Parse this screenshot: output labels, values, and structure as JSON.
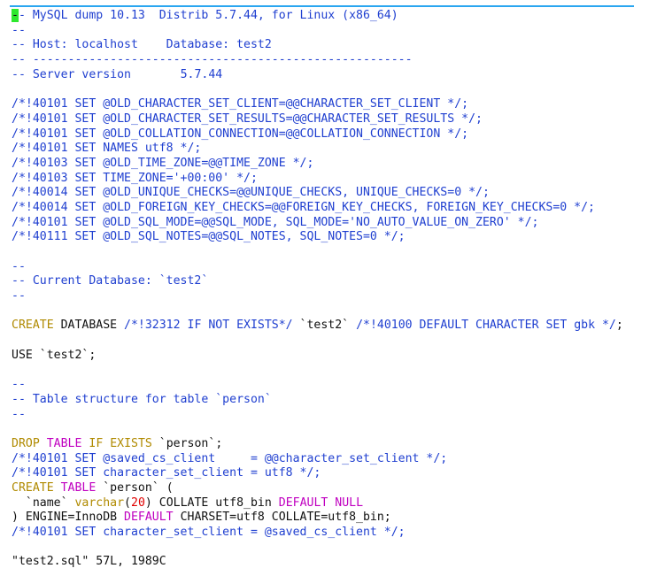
{
  "colors": {
    "accent_bar": "#2aa6f0",
    "cursor": "#2ee82e",
    "comment": "#1f3fd0",
    "keyword": "#b08a00",
    "type": "#c000c0",
    "number": "#e00000",
    "text": "#111111"
  },
  "editor": {
    "cursor_char": "-",
    "l1": "- MySQL dump 10.13  Distrib 5.7.44, for Linux (x86_64)",
    "l2": "--",
    "l3": "-- Host: localhost    Database: test2",
    "l4": "-- ------------------------------------------------------",
    "l5": "-- Server version\t5.7.44",
    "l6": "",
    "l7": "/*!40101 SET @OLD_CHARACTER_SET_CLIENT=@@CHARACTER_SET_CLIENT */;",
    "l8": "/*!40101 SET @OLD_CHARACTER_SET_RESULTS=@@CHARACTER_SET_RESULTS */;",
    "l9": "/*!40101 SET @OLD_COLLATION_CONNECTION=@@COLLATION_CONNECTION */;",
    "l10": "/*!40101 SET NAMES utf8 */;",
    "l11": "/*!40103 SET @OLD_TIME_ZONE=@@TIME_ZONE */;",
    "l12": "/*!40103 SET TIME_ZONE='+00:00' */;",
    "l13": "/*!40014 SET @OLD_UNIQUE_CHECKS=@@UNIQUE_CHECKS, UNIQUE_CHECKS=0 */;",
    "l14": "/*!40014 SET @OLD_FOREIGN_KEY_CHECKS=@@FOREIGN_KEY_CHECKS, FOREIGN_KEY_CHECKS=0 */;",
    "l15": "/*!40101 SET @OLD_SQL_MODE=@@SQL_MODE, SQL_MODE='NO_AUTO_VALUE_ON_ZERO' */;",
    "l16": "/*!40111 SET @OLD_SQL_NOTES=@@SQL_NOTES, SQL_NOTES=0 */;",
    "l17": "",
    "l18": "--",
    "l19": "-- Current Database: `test2`",
    "l20": "--",
    "l21": "",
    "l22": {
      "kw": "CREATE",
      "a": " DATABASE ",
      "c1": "/*!32312 IF NOT EXISTS*/",
      "b": " `test2` ",
      "c2": "/*!40100 DEFAULT CHARACTER SET gbk */",
      "e": ";"
    },
    "l23": "",
    "l24": "USE `test2`;",
    "l25": "",
    "l26": "--",
    "l27": "-- Table structure for table `person`",
    "l28": "--",
    "l29": "",
    "l30": {
      "kw1": "DROP",
      "sp1": " ",
      "kw2": "TABLE",
      "sp2": " ",
      "kw3": "IF",
      "sp3": " ",
      "kw4": "EXISTS",
      "rest": " `person`;"
    },
    "l31": "/*!40101 SET @saved_cs_client     = @@character_set_client */;",
    "l32": "/*!40101 SET character_set_client = utf8 */;",
    "l33": {
      "kw1": "CREATE",
      "sp1": " ",
      "kw2": "TABLE",
      "rest": " `person` ("
    },
    "l34": {
      "pre": "  `name` ",
      "type": "varchar",
      "p1": "(",
      "num": "20",
      "p2": ") COLLATE utf8_bin ",
      "def": "DEFAULT",
      "sp": " ",
      "null": "NULL"
    },
    "l35": {
      "pre": ") ENGINE=InnoDB ",
      "def": "DEFAULT",
      "rest": " CHARSET=utf8 COLLATE=utf8_bin;"
    },
    "l36": "/*!40101 SET character_set_client = @saved_cs_client */;",
    "l37": "",
    "l38": "\"test2.sql\" 57L, 1989C"
  }
}
